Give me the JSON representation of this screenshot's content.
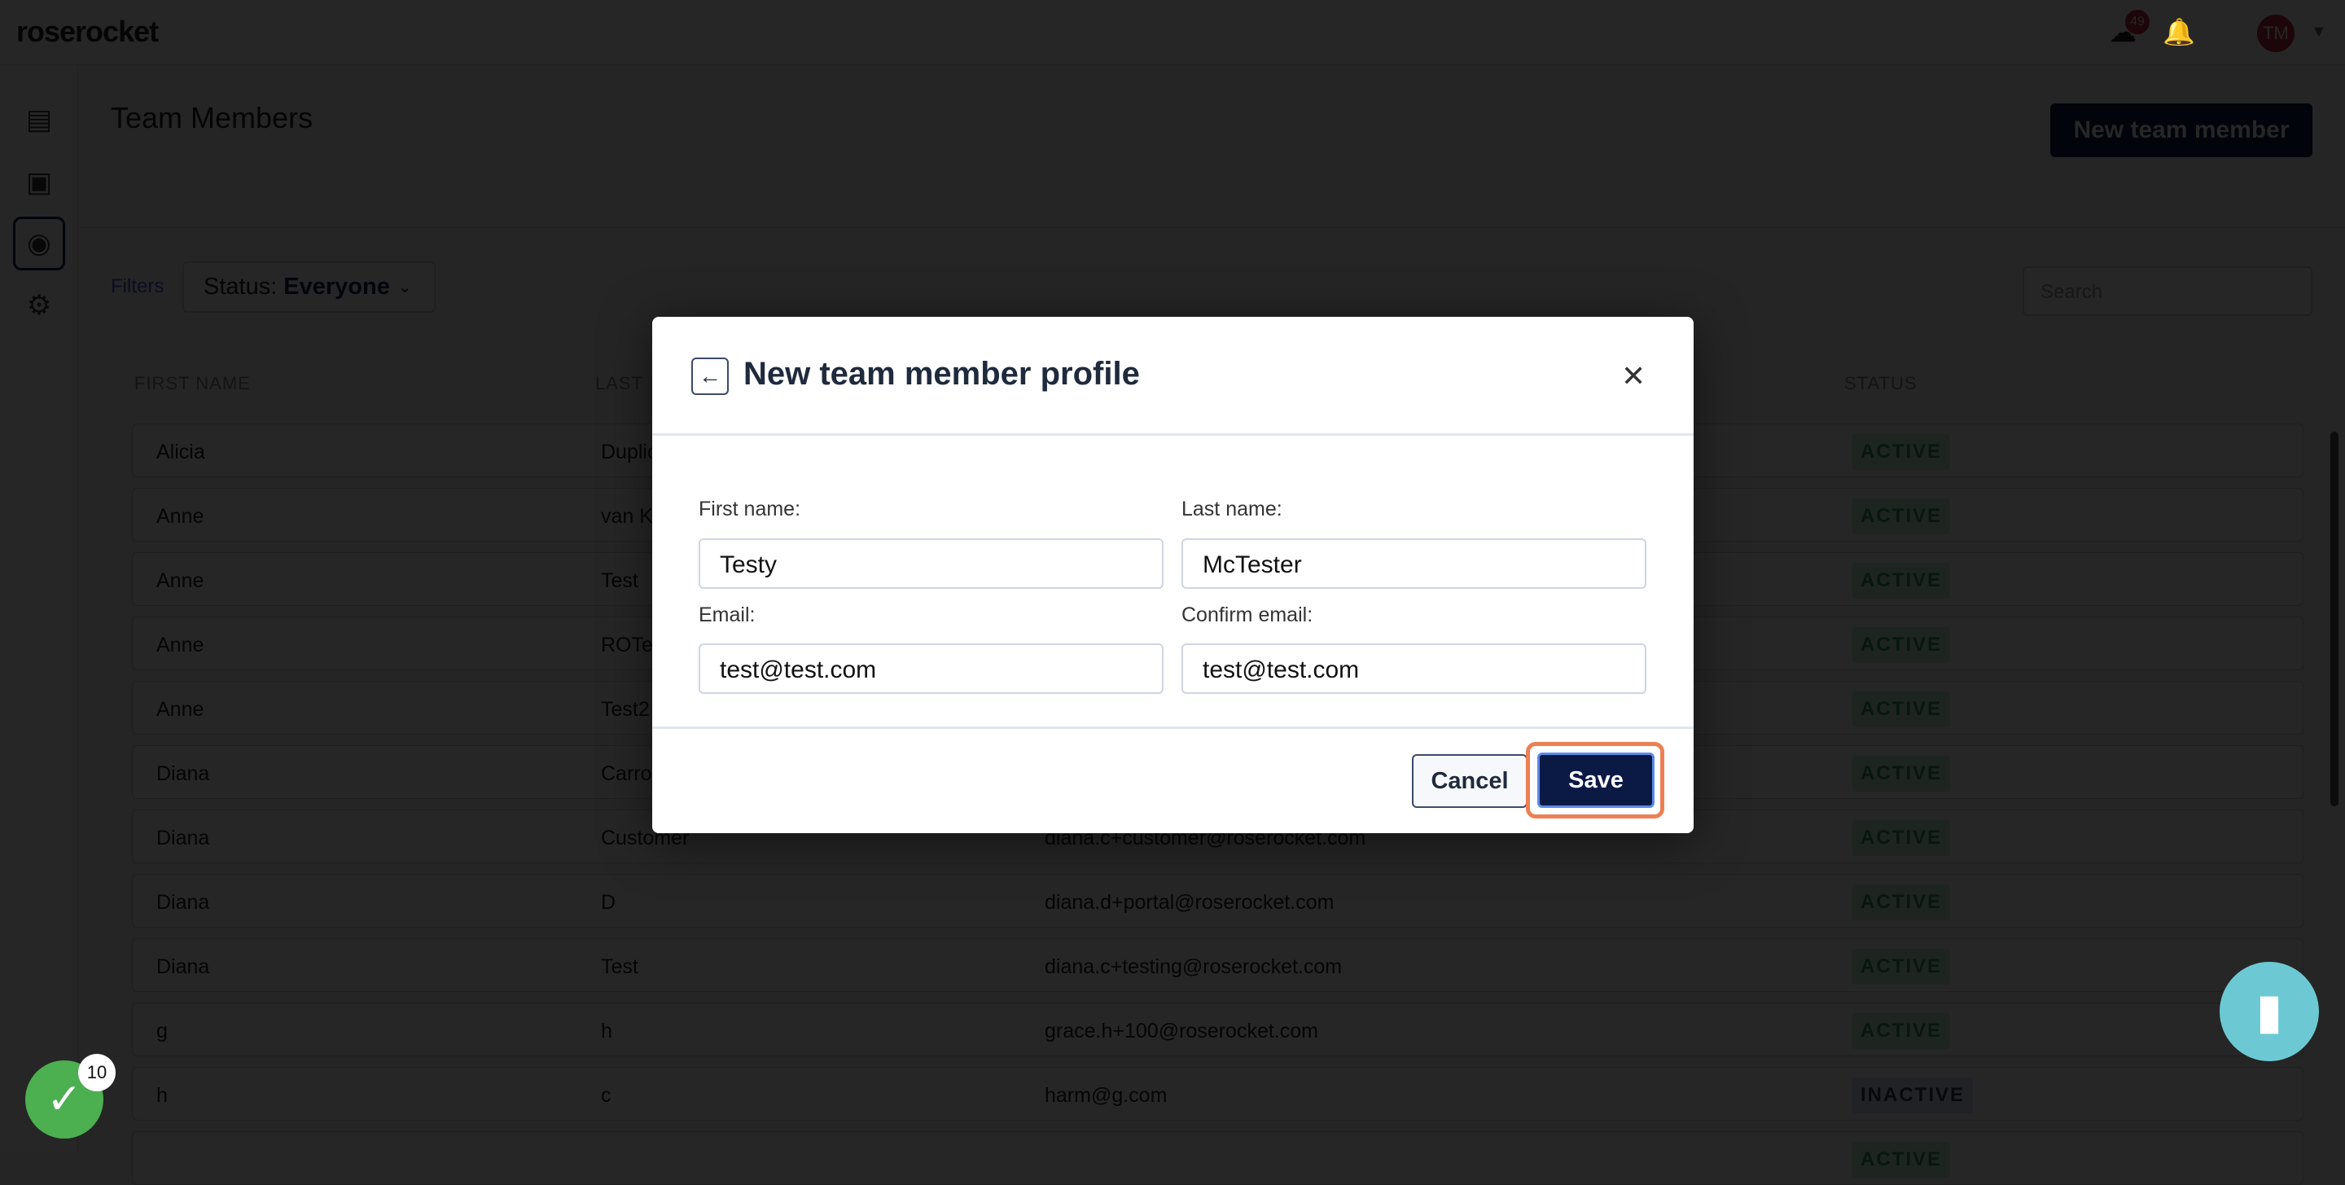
{
  "app": {
    "logo": "roserocket",
    "notification_count": "49",
    "avatar_initials": "TM"
  },
  "page": {
    "title": "Team Members",
    "new_button": "New team member",
    "filters_label": "Filters",
    "status_label": "Status:",
    "status_value": "Everyone",
    "search_placeholder": "Search"
  },
  "table": {
    "headers": [
      "FIRST NAME",
      "LAST",
      "STATUS"
    ],
    "rows": [
      {
        "first": "Alicia",
        "last": "Duplic",
        "email": "",
        "status": "ACTIVE"
      },
      {
        "first": "Anne",
        "last": "van K",
        "email": "",
        "status": "ACTIVE"
      },
      {
        "first": "Anne",
        "last": "Test",
        "email": "",
        "status": "ACTIVE"
      },
      {
        "first": "Anne",
        "last": "ROTe",
        "email": "",
        "status": "ACTIVE"
      },
      {
        "first": "Anne",
        "last": "Test2",
        "email": "",
        "status": "ACTIVE"
      },
      {
        "first": "Diana",
        "last": "Carro",
        "email": "",
        "status": "ACTIVE"
      },
      {
        "first": "Diana",
        "last": "Customer",
        "email": "diana.c+customer@roserocket.com",
        "status": "ACTIVE"
      },
      {
        "first": "Diana",
        "last": "D",
        "email": "diana.d+portal@roserocket.com",
        "status": "ACTIVE"
      },
      {
        "first": "Diana",
        "last": "Test",
        "email": "diana.c+testing@roserocket.com",
        "status": "ACTIVE"
      },
      {
        "first": "g",
        "last": "h",
        "email": "grace.h+100@roserocket.com",
        "status": "ACTIVE"
      },
      {
        "first": "h",
        "last": "c",
        "email": "harm@g.com",
        "status": "INACTIVE"
      },
      {
        "first": "",
        "last": "",
        "email": "",
        "status": "ACTIVE"
      }
    ]
  },
  "modal": {
    "title": "New team member profile",
    "first_name_label": "First name:",
    "first_name_value": "Testy",
    "last_name_label": "Last name:",
    "last_name_value": "McTester",
    "email_label": "Email:",
    "email_value": "test@test.com",
    "confirm_email_label": "Confirm email:",
    "confirm_email_value": "test@test.com",
    "cancel": "Cancel",
    "save": "Save"
  },
  "widgets": {
    "task_count": "10"
  },
  "colors": {
    "primary": "#0b1a45",
    "focus_ring": "#ee7f53",
    "active": "#2f9e5a",
    "chat": "#6cc9d3",
    "check": "#4caf50"
  }
}
